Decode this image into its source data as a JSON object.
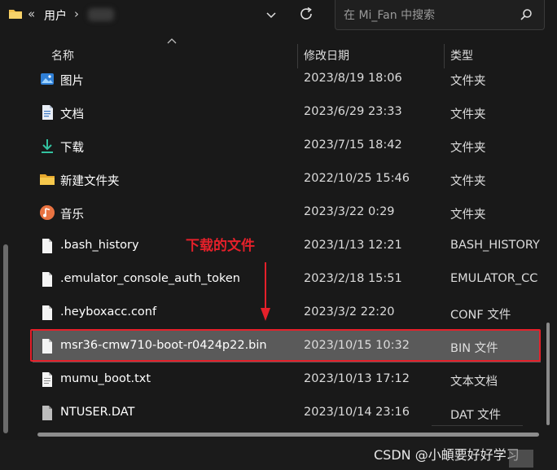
{
  "toolbar": {
    "breadcrumb_root_chevron": "«",
    "breadcrumb_item": "用户",
    "breadcrumb_sep": "›",
    "search_placeholder": "在 Mi_Fan 中搜索"
  },
  "columns": {
    "name": "名称",
    "date": "修改日期",
    "type": "类型"
  },
  "rows": [
    {
      "name": "图片",
      "date": "2023/8/19 18:06",
      "type": "文件夹",
      "icon": "pictures-folder-icon"
    },
    {
      "name": "文档",
      "date": "2023/6/29 23:33",
      "type": "文件夹",
      "icon": "documents-folder-icon"
    },
    {
      "name": "下载",
      "date": "2023/7/15 18:42",
      "type": "文件夹",
      "icon": "downloads-folder-icon"
    },
    {
      "name": "新建文件夹",
      "date": "2022/10/25 15:46",
      "type": "文件夹",
      "icon": "folder-icon"
    },
    {
      "name": "音乐",
      "date": "2023/3/22 0:29",
      "type": "文件夹",
      "icon": "music-folder-icon"
    },
    {
      "name": ".bash_history",
      "date": "2023/1/13 12:21",
      "type": "BASH_HISTORY",
      "icon": "file-icon"
    },
    {
      "name": ".emulator_console_auth_token",
      "date": "2023/2/18 15:51",
      "type": "EMULATOR_CC",
      "icon": "file-icon"
    },
    {
      "name": ".heyboxacc.conf",
      "date": "2023/3/2 22:20",
      "type": "CONF 文件",
      "icon": "file-icon"
    },
    {
      "name": "msr36-cmw710-boot-r0424p22.bin",
      "date": "2023/10/15 10:32",
      "type": "BIN 文件",
      "icon": "file-icon",
      "selected": true
    },
    {
      "name": "mumu_boot.txt",
      "date": "2023/10/13 17:12",
      "type": "文本文档",
      "icon": "text-file-icon"
    },
    {
      "name": "NTUSER.DAT",
      "date": "2023/10/14 23:16",
      "type": "DAT 文件",
      "icon": "dat-file-icon"
    }
  ],
  "annotation": {
    "text": "下载的文件",
    "color": "#e5202a"
  },
  "watermark": "CSDN @小頔要好好学习",
  "colors": {
    "background": "#191919",
    "selected_row": "#5a5a5a",
    "highlight": "#e5202a"
  }
}
